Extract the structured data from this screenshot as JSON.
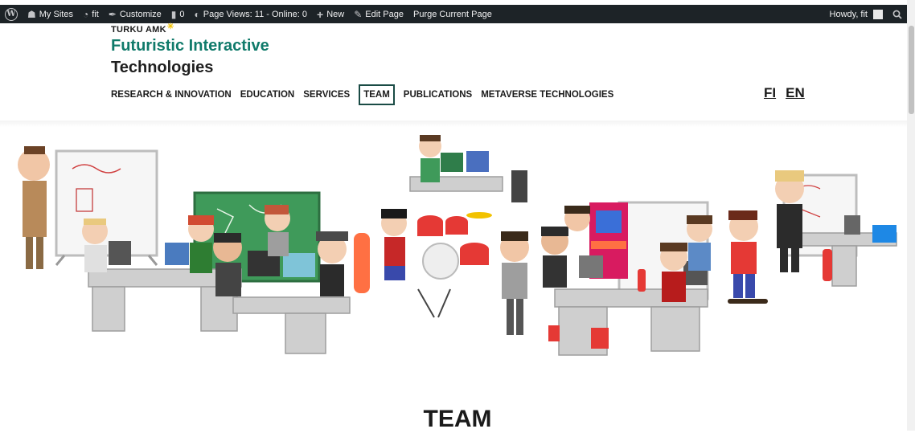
{
  "adminbar": {
    "my_sites": "My Sites",
    "site": "fit",
    "customize": "Customize",
    "comments_count": "0",
    "page_views": "Page Views: 11 - Online: 0",
    "new": "New",
    "edit_page": "Edit Page",
    "purge": "Purge Current Page",
    "howdy": "Howdy, fit"
  },
  "brand": {
    "org": "TURKU AMK",
    "title": "Futuristic Interactive",
    "subtitle": "Technologies"
  },
  "nav": {
    "items": [
      "RESEARCH & INNOVATION",
      "EDUCATION",
      "SERVICES",
      "TEAM",
      "PUBLICATIONS",
      "METAVERSE TECHNOLOGIES"
    ],
    "active": "TEAM"
  },
  "lang": {
    "fi": "FI",
    "en": "EN"
  },
  "page": {
    "heading": "TEAM"
  },
  "colors": {
    "adminbar_bg": "#1d2327",
    "brand_green": "#0f7a6a",
    "nav_active_border": "#1a4b45"
  }
}
